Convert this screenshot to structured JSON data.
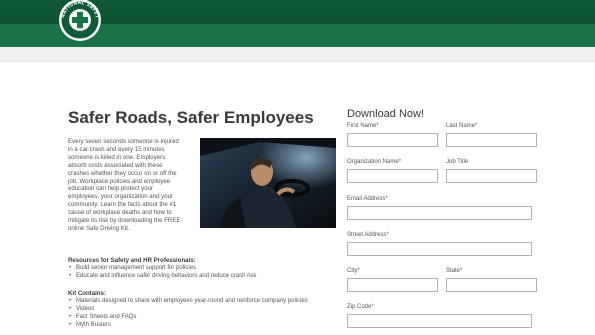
{
  "header": {
    "logo_text": "NATIONAL SAFETY COUNCIL",
    "brand_color": "#0f5a36"
  },
  "main": {
    "title": "Safer Roads, Safer Employees",
    "intro_lines": [
      "Every seven seconds someone is injured",
      "in a car crash and every 15 minutes",
      "someone is killed in one. Employers",
      "absorb costs associated with these",
      "crashes whether they occur on or off the",
      "job. Workplace policies and employee",
      "education can help protect your",
      "employees, your organization and your",
      "community. Learn the facts about the #1",
      "cause of workplace deaths and how to",
      "mitigate its risk by downloading the FREE",
      "online Safe Driving Kit."
    ],
    "resources_heading": "Resources for Safety and HR Professionals:",
    "resources": [
      "Build senior management support for policies",
      "Educate and influence safer driving behaviors and reduce crash risk"
    ],
    "kit_heading": "Kit Contains:",
    "kit_items": [
      "Materials designed to share with employees year-round and reinforce company policies",
      "Videos",
      "Fact Sheets and FAQs",
      "Myth Busters"
    ]
  },
  "form": {
    "title": "Download Now!",
    "first_name_label": "First Name*",
    "last_name_label": "Last Name*",
    "org_label": "Organization Name*",
    "job_label": "Job Title",
    "email_label": "Email Address*",
    "street_label": "Street Address*",
    "city_label": "City*",
    "state_label": "State*",
    "zip_label": "Zip Code*"
  }
}
